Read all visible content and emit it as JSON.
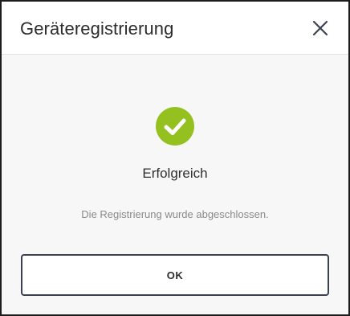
{
  "dialog": {
    "title": "Geräteregistrierung",
    "close_icon": "close-icon",
    "status_icon": "check-circle-icon",
    "status_title": "Erfolgreich",
    "status_message": "Die Registrierung wurde abgeschlossen.",
    "ok_label": "OK"
  },
  "colors": {
    "success": "#94c020",
    "button_border": "#3a4250",
    "header_background": "#ffffff",
    "body_background": "#f7f7f7"
  }
}
